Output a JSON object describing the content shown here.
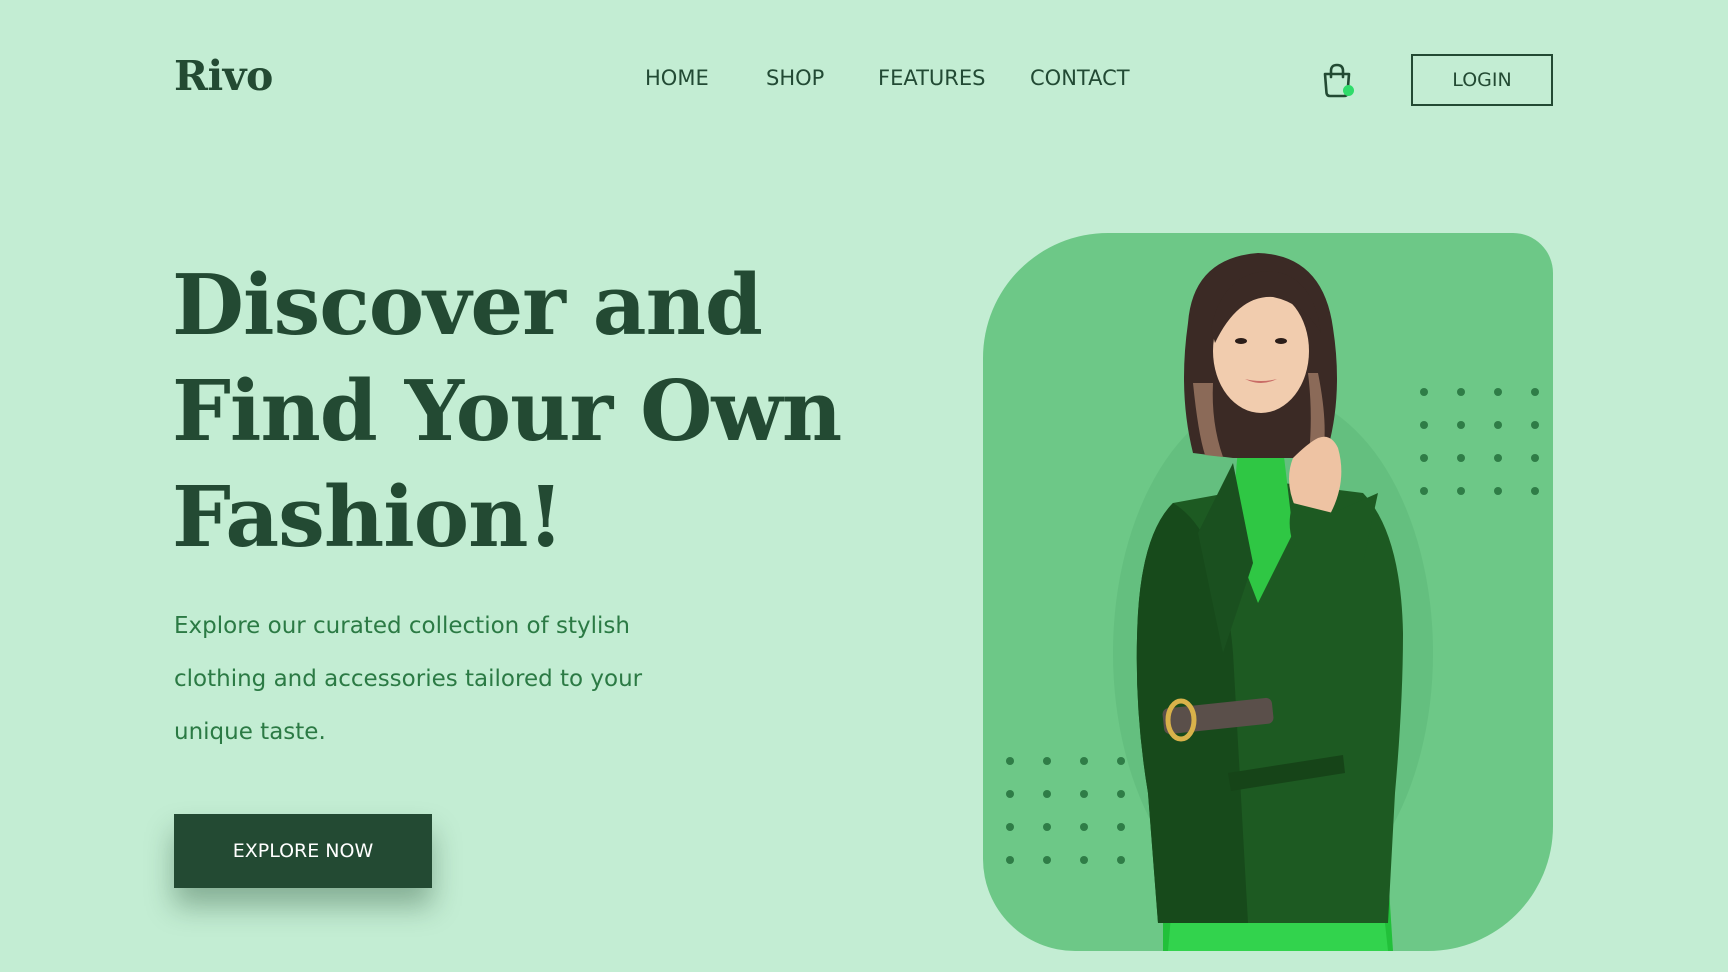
{
  "brand": {
    "logo_text": "Rivo"
  },
  "nav": {
    "items": [
      "HOME",
      "SHOP",
      "FEATURES",
      "CONTACT"
    ]
  },
  "header": {
    "cart_icon": "shopping-bag-icon",
    "cart_badge_color": "#2fdc6a",
    "login_label": "LOGIN"
  },
  "hero": {
    "headline_lines": [
      "Discover and",
      "Find Your Own",
      "Fashion!"
    ],
    "subtext_lines": [
      "Explore our curated collection of stylish",
      "clothing and accessories tailored to your",
      "unique taste."
    ],
    "cta_label": "EXPLORE NOW"
  },
  "colors": {
    "background": "#c3edd3",
    "primary": "#234a33",
    "accent_text": "#2b7a44",
    "card": "#6dc887"
  }
}
